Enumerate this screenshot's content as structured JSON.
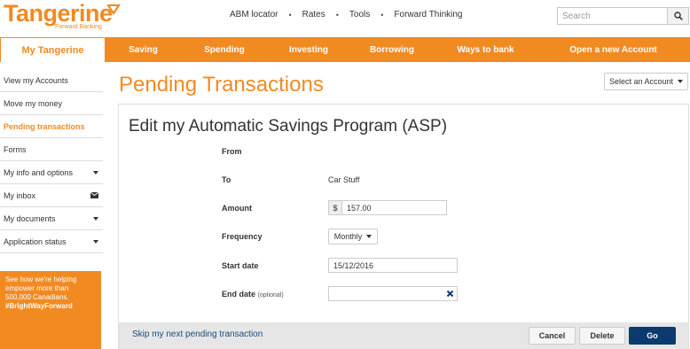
{
  "brand": {
    "name": "Tangerine",
    "tagline": "Forward Banking",
    "accent": "#f28a22",
    "primary_button": "#0b3b6e"
  },
  "top_links": [
    "ABM locator",
    "Rates",
    "Tools",
    "Forward Thinking"
  ],
  "search": {
    "placeholder": "Search",
    "icon": "search-icon"
  },
  "nav": {
    "items": [
      "My Tangerine",
      "Saving",
      "Spending",
      "Investing",
      "Borrowing",
      "Ways to bank",
      "Open a new Account"
    ],
    "active": "My Tangerine"
  },
  "sidebar": {
    "items": [
      {
        "label": "View my Accounts"
      },
      {
        "label": "Move my money"
      },
      {
        "label": "Pending transactions",
        "active": true
      },
      {
        "label": "Forms"
      },
      {
        "label": "My info and options",
        "icon": "caret-down-icon"
      },
      {
        "label": "My inbox",
        "icon": "envelope-icon"
      },
      {
        "label": "My documents",
        "icon": "caret-down-icon"
      },
      {
        "label": "Application status",
        "icon": "caret-down-icon"
      }
    ],
    "promo": {
      "text": "See how we're helping empower more than 500,000 Canadians.",
      "hashtag": "#BrightWayForward"
    }
  },
  "main": {
    "title": "Pending Transactions",
    "account_select": "Select an Account",
    "form": {
      "title": "Edit my Automatic Savings Program (ASP)",
      "from_label": "From",
      "from_value": "",
      "to_label": "To",
      "to_value": "Car Stuff",
      "amount_label": "Amount",
      "currency": "$",
      "amount_value": "157.00",
      "frequency_label": "Frequency",
      "frequency_value": "Monthly",
      "start_label": "Start date",
      "start_value": "15/12/2016",
      "end_label": "End date",
      "end_optional": "(optional)",
      "end_value": ""
    },
    "footer": {
      "skip_link": "Skip my next pending transaction",
      "cancel": "Cancel",
      "delete": "Delete",
      "go": "Go"
    }
  }
}
